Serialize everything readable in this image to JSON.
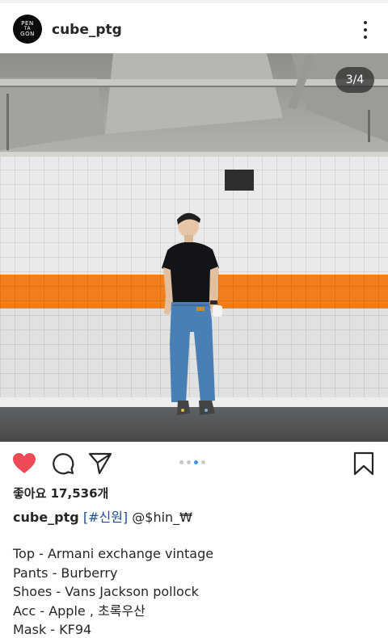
{
  "post": {
    "username": "cube_ptg",
    "avatar_text": [
      "PEN",
      "TA",
      "GON"
    ],
    "more_icon": "more-vertical-icon",
    "counter": "3/4",
    "carousel": {
      "count": 4,
      "active_index": 2
    },
    "likes": "좋아요 17,536개",
    "caption": {
      "username": "cube_ptg",
      "hashtag": "[#신원]",
      "mention": "@$hin_₩"
    },
    "details": [
      "Top - Armani exchange vintage",
      "Pants - Burberry",
      "Shoes - Vans Jackson pollock",
      "Acc - Apple , 초록우산",
      "Mask - KF94"
    ]
  },
  "actions": {
    "like_icon": "heart-icon",
    "comment_icon": "comment-icon",
    "share_icon": "paper-plane-icon",
    "save_icon": "bookmark-icon",
    "liked": true
  },
  "colors": {
    "like_red": "#ed4956",
    "hashtag_blue": "#1d4e8f",
    "dot_active": "#3897f0",
    "stripe_orange": "#f07f1c"
  }
}
